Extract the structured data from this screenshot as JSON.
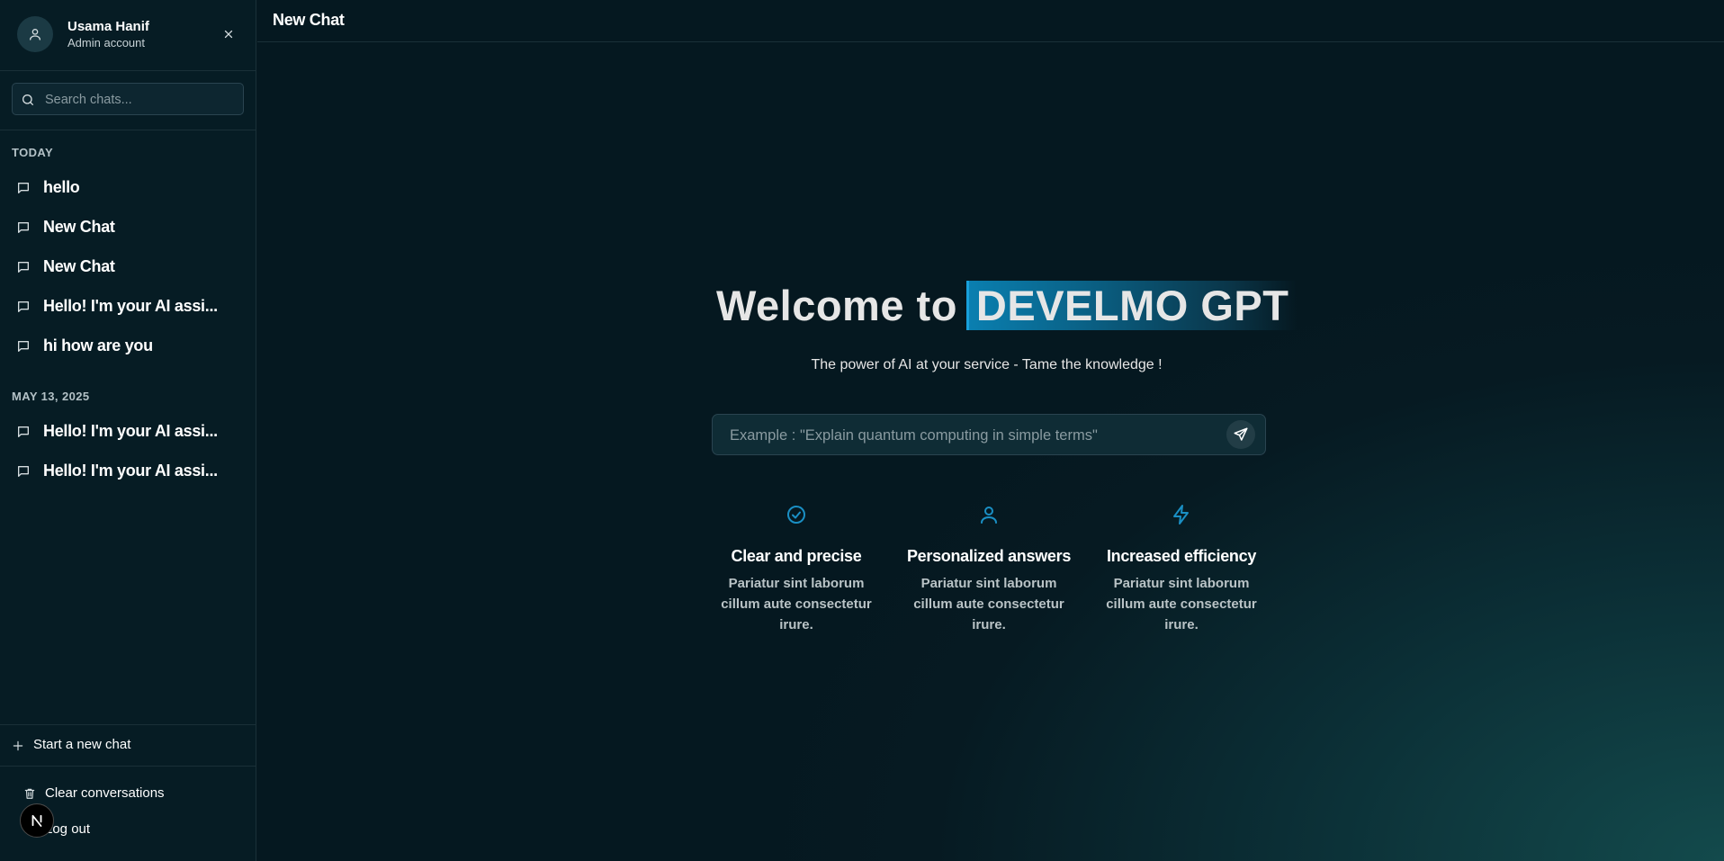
{
  "user": {
    "name": "Usama Hanif",
    "role": "Admin account"
  },
  "search": {
    "placeholder": "Search chats..."
  },
  "history": {
    "today_label": "TODAY",
    "today": [
      {
        "label": "hello"
      },
      {
        "label": "New Chat"
      },
      {
        "label": "New Chat"
      },
      {
        "label": "Hello! I'm your AI assi..."
      },
      {
        "label": "hi how are you"
      }
    ],
    "older_label": "MAY 13, 2025",
    "older": [
      {
        "label": "Hello! I'm your AI assi..."
      },
      {
        "label": "Hello! I'm your AI assi..."
      }
    ]
  },
  "actions": {
    "new_chat": "Start a new chat",
    "clear": "Clear conversations",
    "logout": "Log out"
  },
  "badge": "N",
  "header": {
    "title": "New Chat"
  },
  "hero": {
    "welcome_prefix": "Welcome to",
    "brand": "DEVELMO GPT",
    "tagline": "The power of AI at your service - Tame the knowledge !"
  },
  "prompt": {
    "placeholder": "Example : \"Explain quantum computing in simple terms\""
  },
  "features": [
    {
      "icon": "check-circle-icon",
      "title": "Clear and precise",
      "desc": "Pariatur sint laborum cillum aute consectetur irure."
    },
    {
      "icon": "user-icon",
      "title": "Personalized answers",
      "desc": "Pariatur sint laborum cillum aute consectetur irure."
    },
    {
      "icon": "lightning-icon",
      "title": "Increased efficiency",
      "desc": "Pariatur sint laborum cillum aute consectetur irure."
    }
  ],
  "colors": {
    "accent": "#1a8fc4",
    "background": "#061920",
    "sidebar": "#061c24"
  }
}
